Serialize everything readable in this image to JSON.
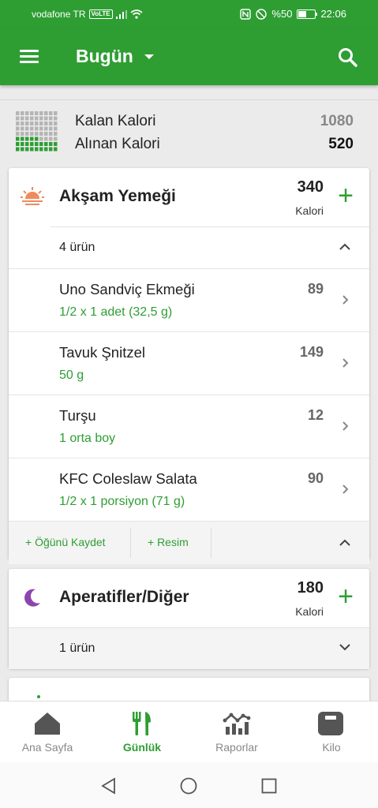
{
  "status_bar": {
    "carrier": "vodafone TR",
    "volte": "VoLTE",
    "battery": "%50",
    "time": "22:06"
  },
  "app_bar": {
    "title": "Bugün",
    "menu_icon": "menu-icon",
    "search_icon": "search-icon"
  },
  "summary": {
    "remaining_label": "Kalan Kalori",
    "remaining_value": "1080",
    "taken_label": "Alınan Kalori",
    "taken_value": "520"
  },
  "dinner": {
    "title": "Akşam Yemeği",
    "calories": "340",
    "unit": "Kalori",
    "icon": "sunset-icon",
    "item_count": "4 ürün",
    "foods": [
      {
        "name": "Uno Sandviç Ekmeği",
        "portion": "1/2 x 1 adet (32,5 g)",
        "kcal": "89"
      },
      {
        "name": "Tavuk Şnitzel",
        "portion": "50  g",
        "kcal": "149"
      },
      {
        "name": "Turşu",
        "portion": "1  orta boy",
        "kcal": "12"
      },
      {
        "name": "KFC Coleslaw Salata",
        "portion": "1/2 x 1 porsiyon (71 g)",
        "kcal": "90"
      }
    ],
    "save_meal": "+ Öğünü Kaydet",
    "add_photo": "+ Resim"
  },
  "snacks": {
    "title": "Aperatifler/Diğer",
    "calories": "180",
    "unit": "Kalori",
    "icon": "moon-icon",
    "item_count": "1 ürün"
  },
  "bottom_nav": [
    {
      "label": "Ana Sayfa",
      "icon": "home-icon"
    },
    {
      "label": "Günlük",
      "icon": "utensils-icon"
    },
    {
      "label": "Raporlar",
      "icon": "chart-icon"
    },
    {
      "label": "Kilo",
      "icon": "scale-icon"
    }
  ],
  "colors": {
    "brand_green": "#2e9e33",
    "sunset_orange": "#f08a5d",
    "moon_purple": "#8e44ad"
  }
}
